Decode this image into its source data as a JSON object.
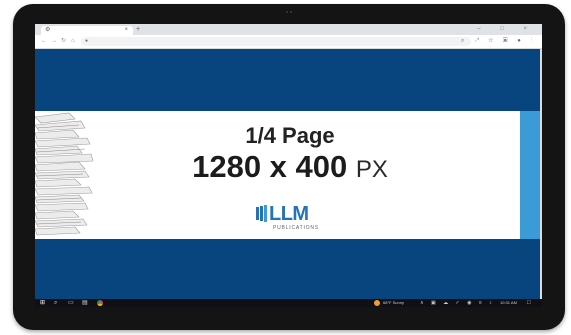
{
  "browser": {
    "tab_icon": "⚙",
    "tab_close": "×",
    "new_tab": "+",
    "window_controls": "– □ ×",
    "nav": {
      "back": "←",
      "forward": "→",
      "reload": "↻",
      "home": "⌂"
    },
    "address_icon": "●",
    "toolbar_icons": "⌕ ↗ ☆ ▣ ● ⋮"
  },
  "banner": {
    "line1": "1/4 Page",
    "line2_main": "1280 x 400",
    "line2_unit": "PX",
    "logo_word": "LLM",
    "logo_sub": "PUBLICATIONS"
  },
  "taskbar": {
    "start": "⊞",
    "search": "⌕",
    "taskview": "▭",
    "files": "▤",
    "weather_text": "68°F Sunny",
    "tray_icons": "∧ ▣ ☁ ✓ ◉ ≡ ♪",
    "clock": "10:31 AM",
    "notifications": "□"
  },
  "colors": {
    "page_background": "#08457e",
    "accent_bar": "#3a9bd6",
    "logo_blue": "#2572b6"
  }
}
